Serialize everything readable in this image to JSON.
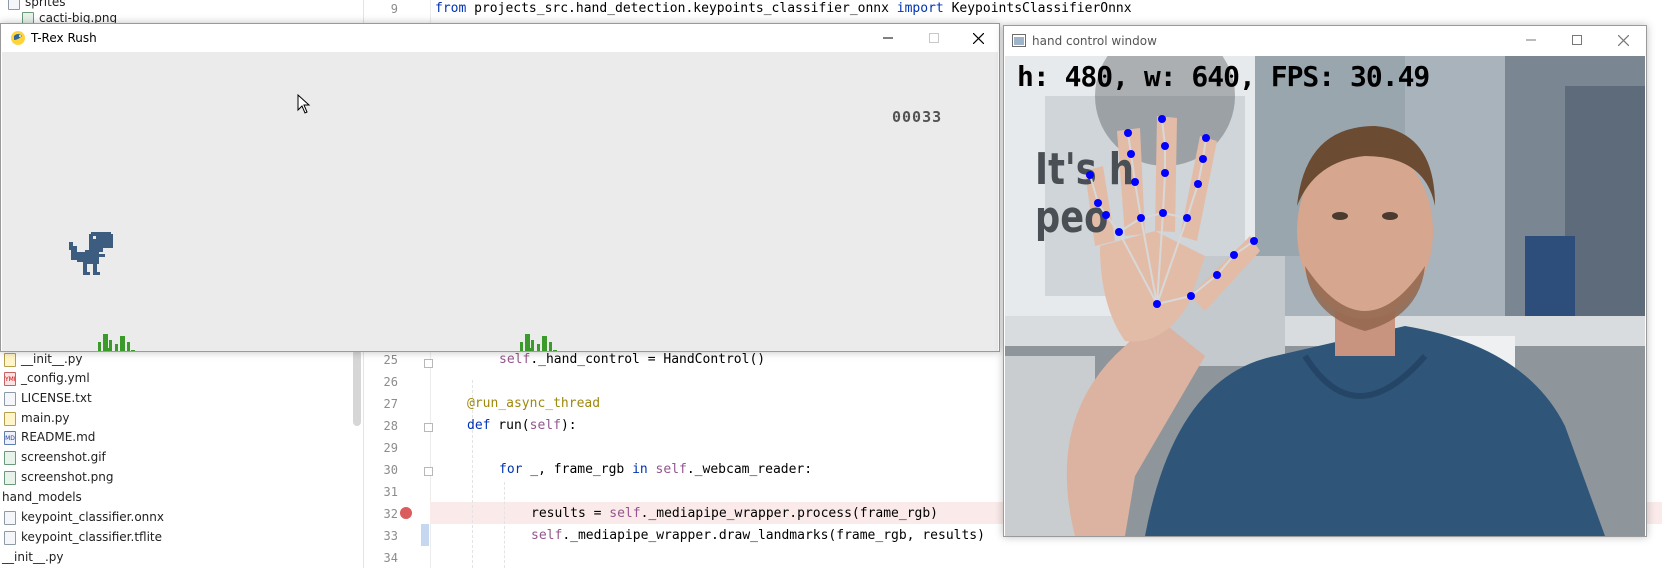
{
  "project_tree": {
    "items": [
      {
        "label": "sprites",
        "icon": "folder-icon"
      },
      {
        "label": "cacti-big.png",
        "icon": "image-file-icon"
      },
      {
        "label": "__init__.py",
        "icon": "python-file-icon"
      },
      {
        "label": "_config.yml",
        "icon": "yml-file-icon"
      },
      {
        "label": "LICENSE.txt",
        "icon": "text-file-icon"
      },
      {
        "label": "main.py",
        "icon": "python-file-icon"
      },
      {
        "label": "README.md",
        "icon": "markdown-file-icon"
      },
      {
        "label": "screenshot.gif",
        "icon": "image-file-icon"
      },
      {
        "label": "screenshot.png",
        "icon": "image-file-icon"
      },
      {
        "label": "hand_models",
        "icon": "folder-icon"
      },
      {
        "label": "keypoint_classifier.onnx",
        "icon": "file-icon"
      },
      {
        "label": "keypoint_classifier.tflite",
        "icon": "file-icon"
      },
      {
        "label": "__init__.py",
        "icon": "python-file-icon"
      }
    ]
  },
  "editor": {
    "lines": [
      {
        "num": "9",
        "text_a": "from",
        "text_b": " projects_src.hand_detection.keypoints_classifier_onnx ",
        "text_c": "import",
        "text_d": " KeypointsClassifierOnnx"
      },
      {
        "num": "25",
        "text_a": "self",
        "text_b": "._hand_control = HandControl()"
      },
      {
        "num": "26"
      },
      {
        "num": "27",
        "text_a": "@run_async_thread"
      },
      {
        "num": "28",
        "text_a": "def",
        "text_b": " run(",
        "text_c": "self",
        "text_d": "):"
      },
      {
        "num": "29"
      },
      {
        "num": "30",
        "text_a": "for",
        "text_b": " _, frame_rgb ",
        "text_c": "in",
        "text_d": " ",
        "text_e": "self",
        "text_f": "._webcam_reader:"
      },
      {
        "num": "31"
      },
      {
        "num": "32",
        "text_a": "results = ",
        "text_b": "self",
        "text_c": "._mediapipe_wrapper.process(frame_rgb)"
      },
      {
        "num": "33",
        "text_a": "self",
        "text_b": "._mediapipe_wrapper.draw_landmarks(frame_rgb, results)"
      },
      {
        "num": "34"
      }
    ]
  },
  "trex_window": {
    "title": "T-Rex Rush",
    "score": "00033",
    "colors": {
      "dino": "#3c5c80",
      "cactus": "#3a9a2a",
      "ground": "#535353",
      "background": "#ebebeb"
    }
  },
  "hand_window": {
    "title": "hand control window",
    "overlay_text": "h: 480, w: 640, FPS: 30.49",
    "wall_text_line1": "It's h",
    "wall_text_line2": "peo",
    "landmark_color": "#0000ff"
  }
}
